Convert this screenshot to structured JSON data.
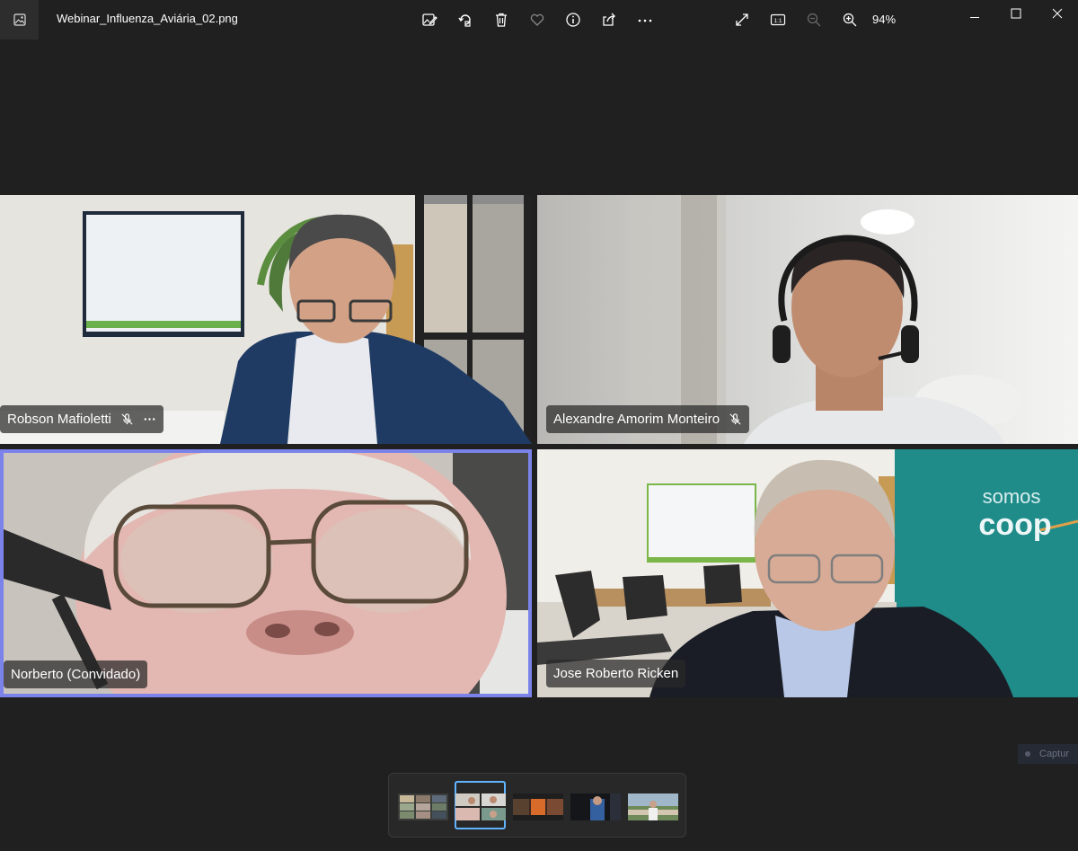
{
  "titlebar": {
    "filename": "Webinar_Influenza_Aviária_02.png",
    "zoom_level": "94%",
    "toolbar_icons": [
      "edit-image-icon",
      "rotate-icon",
      "delete-icon",
      "favorite-icon",
      "info-icon",
      "share-icon",
      "more-icon"
    ],
    "view_icons": [
      "fullscreen-icon",
      "actual-size-icon",
      "zoom-out-icon",
      "zoom-in-icon"
    ],
    "actual_size_label": "1:1"
  },
  "participants": [
    {
      "name": "Robson Mafioletti",
      "muted": true,
      "more": true
    },
    {
      "name": "Alexandre Amorim Monteiro",
      "muted": true,
      "more": false
    },
    {
      "name": "Norberto (Convidado)",
      "muted": false,
      "active_speaker": true
    },
    {
      "name": "Jose Roberto Ricken",
      "muted": false
    }
  ],
  "room_branding": {
    "line1": "somos",
    "line2": "coop"
  },
  "filmstrip": {
    "count": 5,
    "selected_index": 1
  },
  "capture_label": "Captur",
  "colors": {
    "background": "#202020",
    "active_border": "#7b83eb",
    "thumb_selected": "#60b4ff"
  }
}
